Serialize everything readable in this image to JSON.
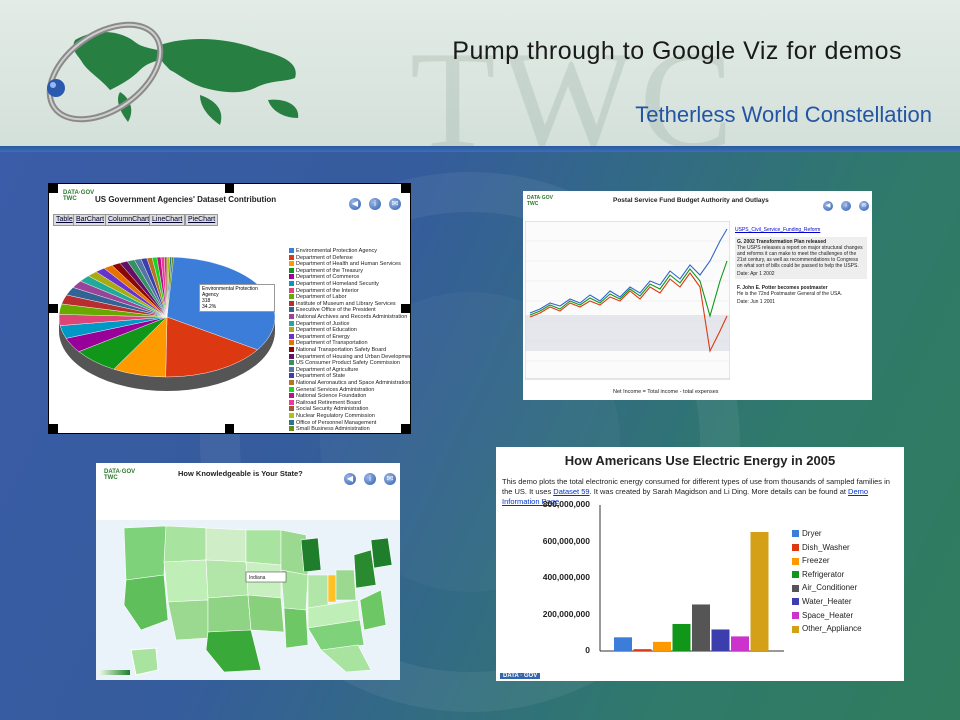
{
  "slide": {
    "title": "Pump through to Google Viz for demos",
    "subtitle": "Tetherless World Constellation",
    "watermark": "TWC"
  },
  "panel_agencies": {
    "logo": "DATA·GOV TWC",
    "title": "US Government Agencies' Dataset Contribution",
    "tabs": [
      "Table",
      "BarChart",
      "ColumnChart",
      "LineChart",
      "PieChart"
    ],
    "tooltip_name": "Environmental Protection Agency",
    "tooltip_count": "318",
    "tooltip_pct": "34.2%",
    "legend": [
      {
        "label": "Environmental Protection Agency",
        "color": "#3b7dd8"
      },
      {
        "label": "Department of Defense",
        "color": "#dc3912"
      },
      {
        "label": "Department of Health and Human Services",
        "color": "#ff9900"
      },
      {
        "label": "Department of the Treasury",
        "color": "#109618"
      },
      {
        "label": "Department of Commerce",
        "color": "#990099"
      },
      {
        "label": "Department of Homeland Security",
        "color": "#0099c6"
      },
      {
        "label": "Department of the Interior",
        "color": "#dd4477"
      },
      {
        "label": "Department of Labor",
        "color": "#66aa00"
      },
      {
        "label": "Institute of Museum and Library Services",
        "color": "#b82e2e"
      },
      {
        "label": "Executive Office of the President",
        "color": "#316395"
      },
      {
        "label": "National Archives and Records Administration",
        "color": "#994499"
      },
      {
        "label": "Department of Justice",
        "color": "#22aa99"
      },
      {
        "label": "Department of Education",
        "color": "#aaaa11"
      },
      {
        "label": "Department of Energy",
        "color": "#6633cc"
      },
      {
        "label": "Department of Transportation",
        "color": "#e67300"
      },
      {
        "label": "National Transportation Safety Board",
        "color": "#8b0707"
      },
      {
        "label": "Department of Housing and Urban Development",
        "color": "#651067"
      },
      {
        "label": "US Consumer Product Safety Commission",
        "color": "#329262"
      },
      {
        "label": "Department of Agriculture",
        "color": "#5574a6"
      },
      {
        "label": "Department of State",
        "color": "#3b3eac"
      },
      {
        "label": "National Aeronautics and Space Administration",
        "color": "#b77322"
      },
      {
        "label": "General Services Administration",
        "color": "#16d620"
      },
      {
        "label": "National Science Foundation",
        "color": "#b91383"
      },
      {
        "label": "Railroad Retirement Board",
        "color": "#f4359e"
      },
      {
        "label": "Social Security Administration",
        "color": "#9c5935"
      },
      {
        "label": "Nuclear Regulatory Commission",
        "color": "#a9c413"
      },
      {
        "label": "Office of Personnel Management",
        "color": "#2a778d"
      },
      {
        "label": "Small Business Administration",
        "color": "#668d1c"
      }
    ]
  },
  "panel_postal": {
    "logo": "DATA·GOV TWC",
    "title": "Postal Service Fund Budget Authority and Outlays",
    "footer": "Net Income = Total income - total expenses",
    "notes": [
      {
        "lines": [
          "USPS_Civil_Service_Funding_Reform"
        ]
      },
      {
        "head": "G. 2002 Transformation Plan released",
        "text": "The USPS releases a report on major structural changes and reforms it can make to meet the challenges of the 21st century, as well as recommendations to Congress on what sort of bills could be passed to help the USPS.",
        "date": "Date: Apr 1 2002"
      },
      {
        "head": "F. John E. Potter becomes postmaster",
        "text": "He is the 72nd Postmaster General of the USA.",
        "date": "Date: Jun 1 2001"
      }
    ]
  },
  "panel_state": {
    "logo": "DATA·GOV TWC",
    "title": "How Knowledgeable is Your State?",
    "tooltip": "Indiana"
  },
  "panel_energy": {
    "title": "How Americans Use Electric Energy in 2005",
    "desc_pre": "This demo plots the total electronic energy consumed for different types of use from thousands of sampled families in the US. It uses ",
    "link1": "Dataset 59",
    "desc_mid": ". It was created by Sarah Magidson and Li Ding. More details can be found at ",
    "link2": "Demo Information Page",
    "desc_post": ".",
    "footer_logo": "DATA · GOV"
  },
  "chart_data": [
    {
      "type": "bar",
      "title": "How Americans Use Electric Energy in 2005",
      "categories": [
        "Dryer",
        "Dish_Washer",
        "Freezer",
        "Refrigerator",
        "Air_Conditioner",
        "Water_Heater",
        "Space_Heater",
        "Other_Appliance"
      ],
      "values": [
        75000000,
        10000000,
        50000000,
        148000000,
        255000000,
        118000000,
        80000000,
        652000000
      ],
      "colors": [
        "#3b7dd8",
        "#dc3912",
        "#ff9900",
        "#109618",
        "#555555",
        "#3b3eac",
        "#cc33cc",
        "#d4a017"
      ],
      "ylim": [
        0,
        800000000
      ],
      "yticks": [
        "0",
        "200,000,000",
        "400,000,000",
        "600,000,000",
        "800,000,000"
      ],
      "legend_position": "right",
      "grid": false
    }
  ]
}
